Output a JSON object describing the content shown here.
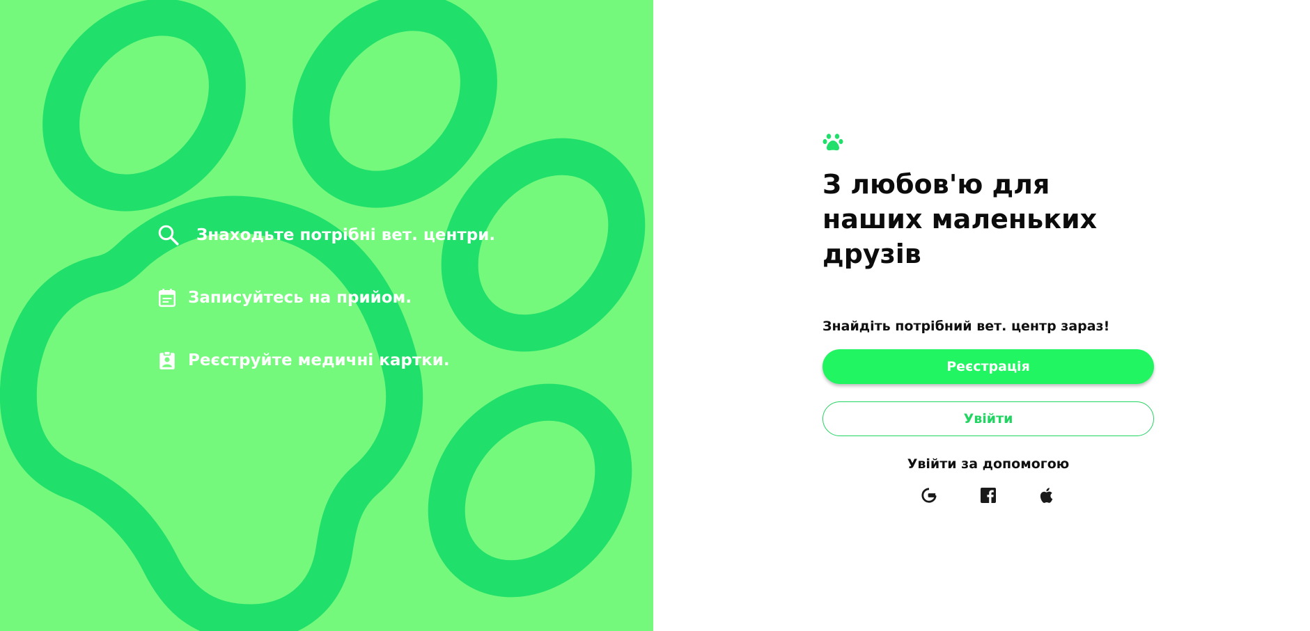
{
  "colors": {
    "left_bg": "#74f97c",
    "paw_stroke": "#20df6b",
    "accent": "#22f562",
    "accent_border": "#22d461",
    "text_dark": "#0c0c0c",
    "white": "#ffffff"
  },
  "features": [
    {
      "icon": "search-icon",
      "label": "Знаходьте потрібні вет. центри."
    },
    {
      "icon": "calendar-icon",
      "label": "Записуйтесь на прийом."
    },
    {
      "icon": "medical-card-icon",
      "label": "Реєструйте медичні картки."
    }
  ],
  "main": {
    "logo_icon": "paw-icon",
    "headline": "З любов'ю для наших маленьких друзів",
    "subtitle": "Знайдіть потрібний вет. центр зараз!",
    "register_label": "Реєстрація",
    "login_label": "Увійти",
    "social_title": "Увійти за допомогою",
    "social": [
      {
        "icon": "google-icon"
      },
      {
        "icon": "facebook-icon"
      },
      {
        "icon": "apple-icon"
      }
    ]
  }
}
